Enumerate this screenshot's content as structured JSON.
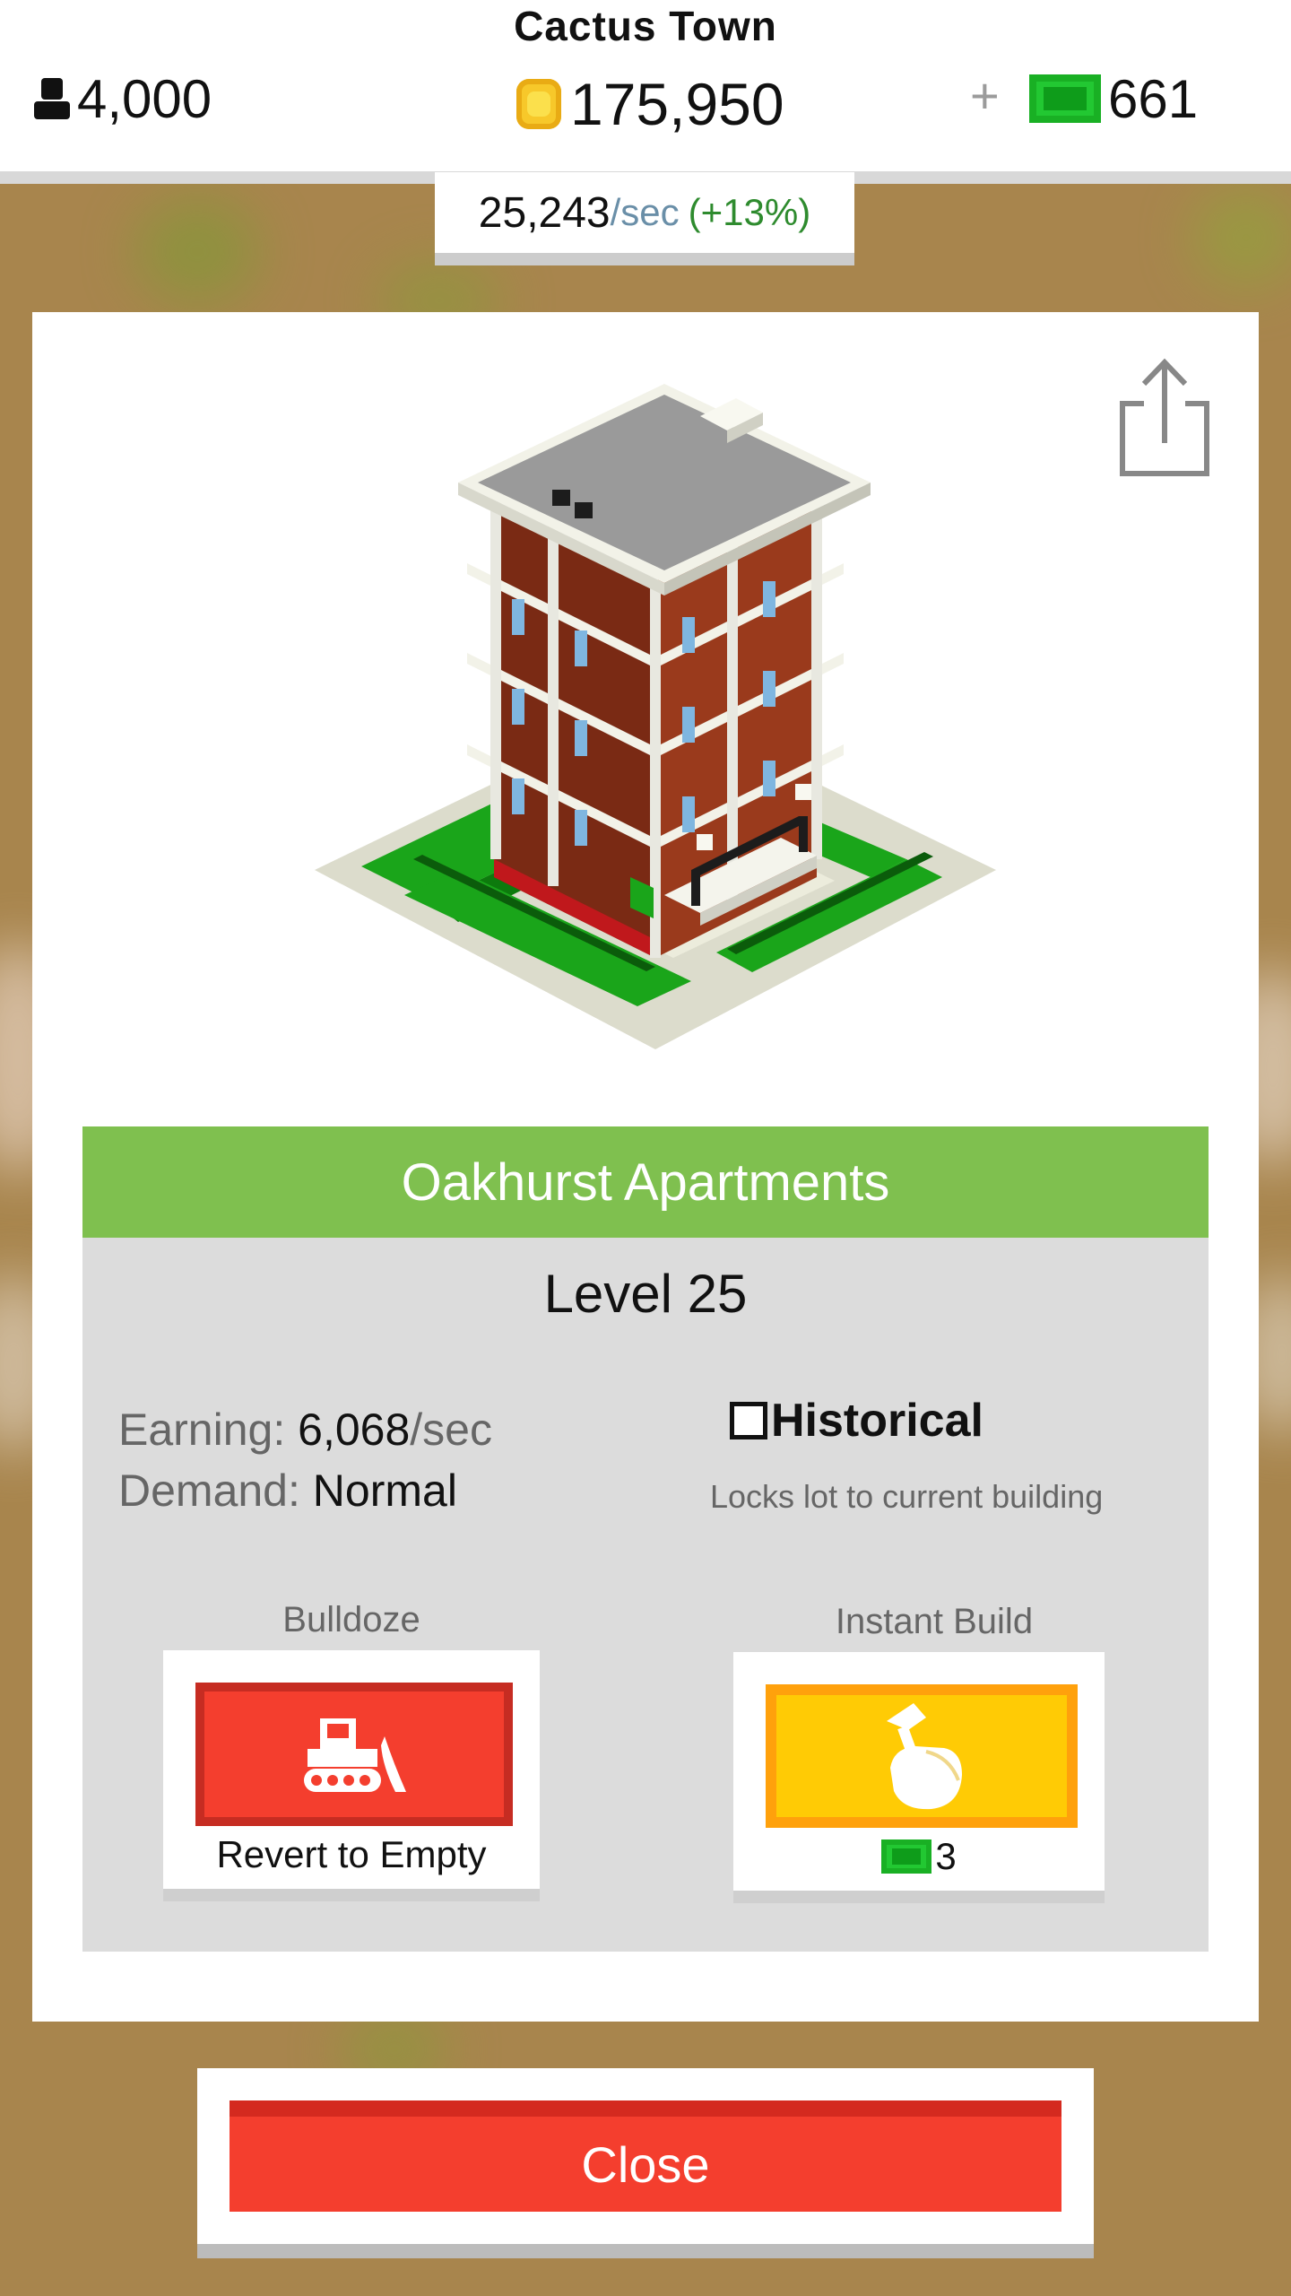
{
  "header": {
    "town_name": "Cactus Town",
    "population": "4,000",
    "coins": "175,950",
    "plus_symbol": "+",
    "cash": "661"
  },
  "income": {
    "rate": "25,243",
    "unit": "/sec",
    "bonus": "(+13%)"
  },
  "building": {
    "name": "Oakhurst Apartments",
    "level": "Level 25",
    "earning_label": "Earning:",
    "earning_value": "6,068",
    "earning_unit": "/sec",
    "demand_label": "Demand:",
    "demand_value": "Normal",
    "historical_label": "Historical",
    "historical_checked": false,
    "historical_sub": "Locks lot to current building"
  },
  "actions": {
    "bulldoze_title": "Bulldoze",
    "bulldoze_label": "Revert to Empty",
    "instant_title": "Instant Build",
    "instant_cost": "3"
  },
  "close_label": "Close",
  "icons": {
    "population": "person-icon",
    "coins": "coin-icon",
    "cash": "cash-icon",
    "share": "share-icon",
    "bulldoze": "bulldozer-icon",
    "instant": "hammer-hand-icon"
  },
  "colors": {
    "name_bar": "#7fc04f",
    "bulldoze": "#f43e2e",
    "instant": "#ffcb05",
    "close": "#f43e2e",
    "cash": "#22c832",
    "coin": "#f7c82a"
  }
}
